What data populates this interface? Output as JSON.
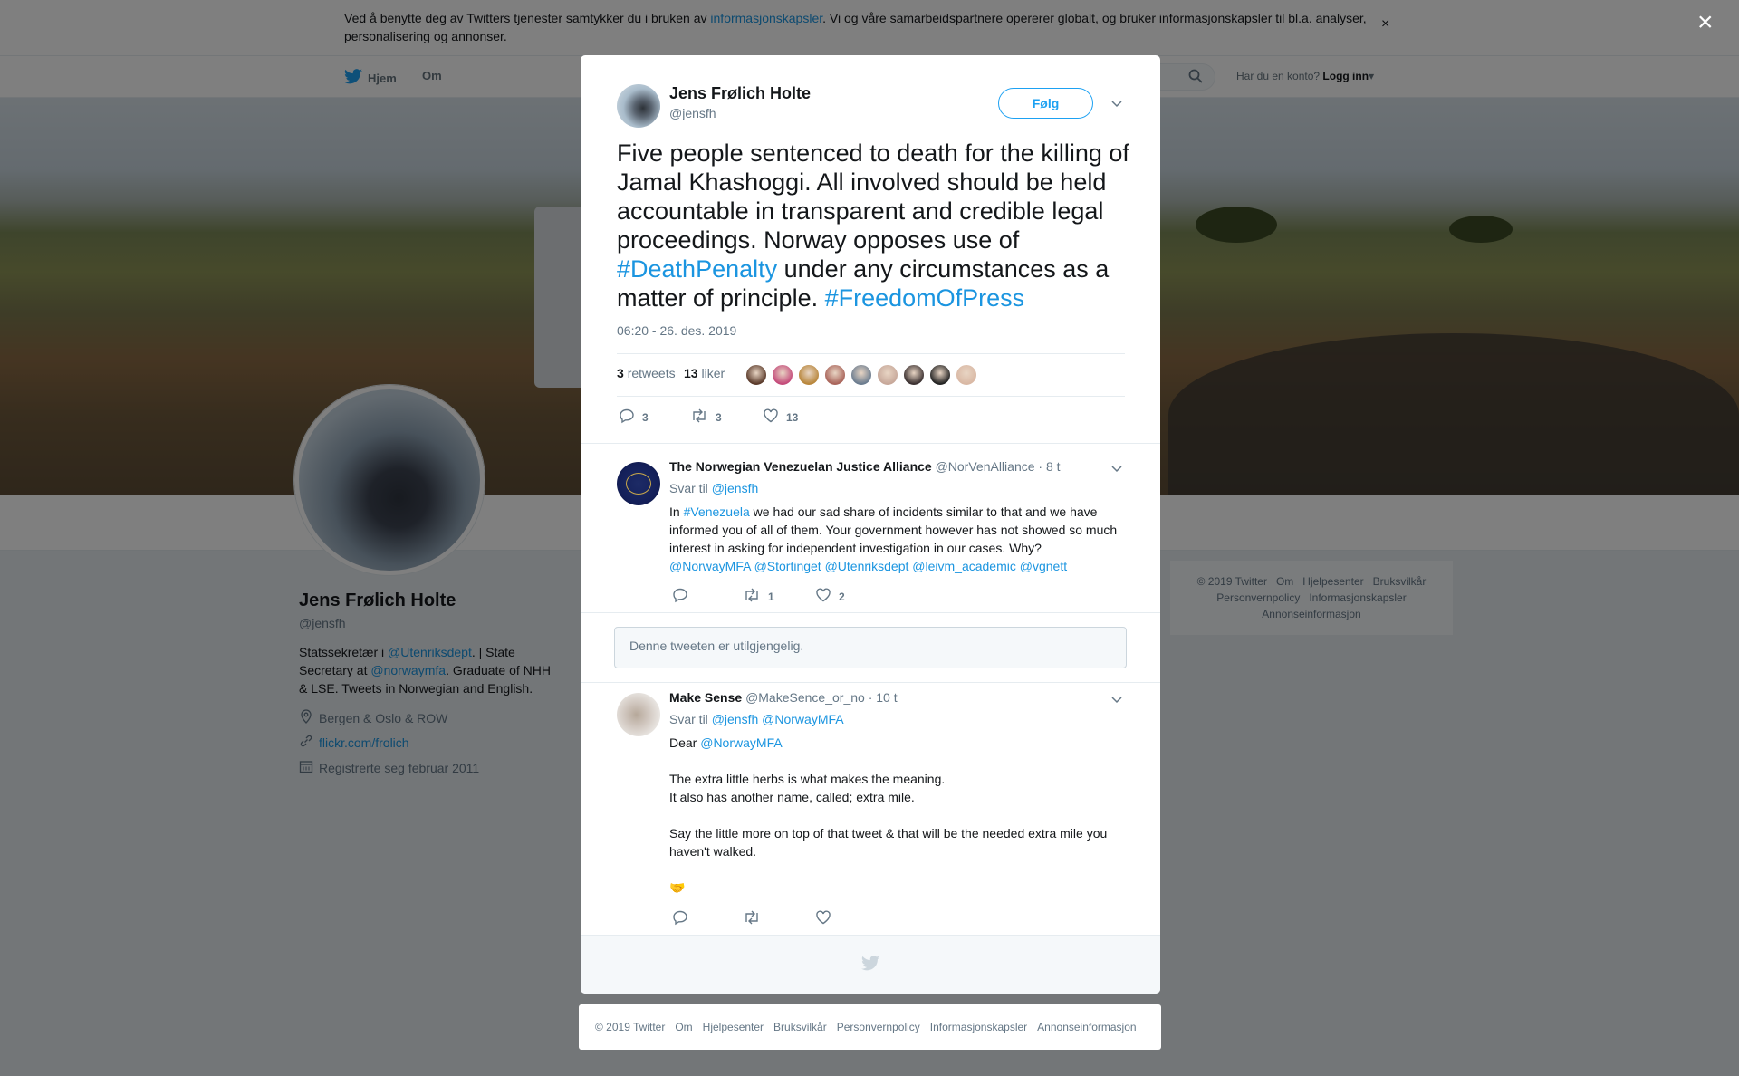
{
  "cookie_banner": {
    "text_before": "Ved å benytte deg av Twitters tjenester samtykker du i bruken av ",
    "link": "informasjonskapsler",
    "text_after": ". Vi og våre samarbeidspartnere opererer globalt, og bruker informasjonskapsler til bl.a. analyser, personalisering og annonser.",
    "close": "×"
  },
  "nav": {
    "home": "Hjem",
    "about": "Om",
    "login_prompt": "Har du en konto?",
    "login": "Logg inn"
  },
  "profile": {
    "name": "Jens Frølich Holte",
    "handle": "@jensfh",
    "bio_1": "Statssekretær i ",
    "bio_link_1": "@Utenriksdept",
    "bio_2": ". | State Secretary at ",
    "bio_link_2": "@norwaymfa",
    "bio_3": ". Graduate of NHH & LSE. Tweets in Norwegian and English.",
    "location": "Bergen & Oslo & ROW",
    "website": "flickr.com/frolich",
    "joined": "Registrerte seg februar 2011"
  },
  "side_footer": [
    "© 2019 Twitter",
    "Om",
    "Hjelpesenter",
    "Bruksvilkår",
    "Personvernpolicy",
    "Informasjonskapsler",
    "Annonseinformasjon"
  ],
  "overlay_close": "×",
  "tweet": {
    "name": "Jens Frølich Holte",
    "handle": "@jensfh",
    "follow": "Følg",
    "text_1": "Five people sentenced to death for the killing of Jamal Khashoggi. All involved should be held accountable in transparent and credible legal proceedings. Norway opposes use of ",
    "hashtag_1": "#DeathPenalty",
    "text_2": " under any circumstances as a matter of principle. ",
    "hashtag_2": "#FreedomOfPress",
    "time": "06:20 - 26. des. 2019",
    "retweets_count": "3",
    "retweets_label": "retweets",
    "likes_count": "13",
    "likes_label": "liker",
    "reply_count": "3",
    "retweet_count": "3",
    "like_count": "13",
    "likers": [
      "#5a3a2a",
      "#c44a7a",
      "#b8863b",
      "#a9645a",
      "#6b7c8f",
      "#c7a89a",
      "#3a3030",
      "#222222",
      "#d9b8a4"
    ]
  },
  "replies": [
    {
      "name": "The Norwegian Venezuelan Justice Alliance",
      "handle": "@NorVenAlliance",
      "time": "· 8 t",
      "reply_to_label": "Svar til",
      "reply_to": "@jensfh",
      "text_in": "In ",
      "hashtag": "#Venezuela",
      "text": " we had our sad share of incidents similar to that and we have informed you of all of them. Your government however has not showed so much interest in asking for independent investigation in our cases. Why?",
      "mentions": "@NorwayMFA @Stortinget @Utenriksdept @leivm_academic @vgnett",
      "reply_count": "",
      "retweet_count": "1",
      "like_count": "2"
    },
    {
      "unavailable": "Denne tweeten er utilgjengelig."
    },
    {
      "name": "Make Sense",
      "handle": "@MakeSence_or_no",
      "time": "· 10 t",
      "reply_to_label": "Svar til",
      "reply_to": "@jensfh @NorwayMFA",
      "greeting": "Dear ",
      "greeting_mention": "@NorwayMFA",
      "line_1": "The extra little herbs is what makes the meaning.",
      "line_2": "It also has another name, called; extra mile.",
      "line_3": "Say the little more on top of that tweet & that will be the needed extra mile you haven't walked.",
      "emoji": "🤝"
    }
  ],
  "bottom_footer": [
    "© 2019 Twitter",
    "Om",
    "Hjelpesenter",
    "Bruksvilkår",
    "Personvernpolicy",
    "Informasjonskapsler",
    "Annonseinformasjon"
  ],
  "colors": {
    "accent": "#1da1f2",
    "link": "#1b95e0",
    "text": "#14171a",
    "muted": "#657786"
  }
}
